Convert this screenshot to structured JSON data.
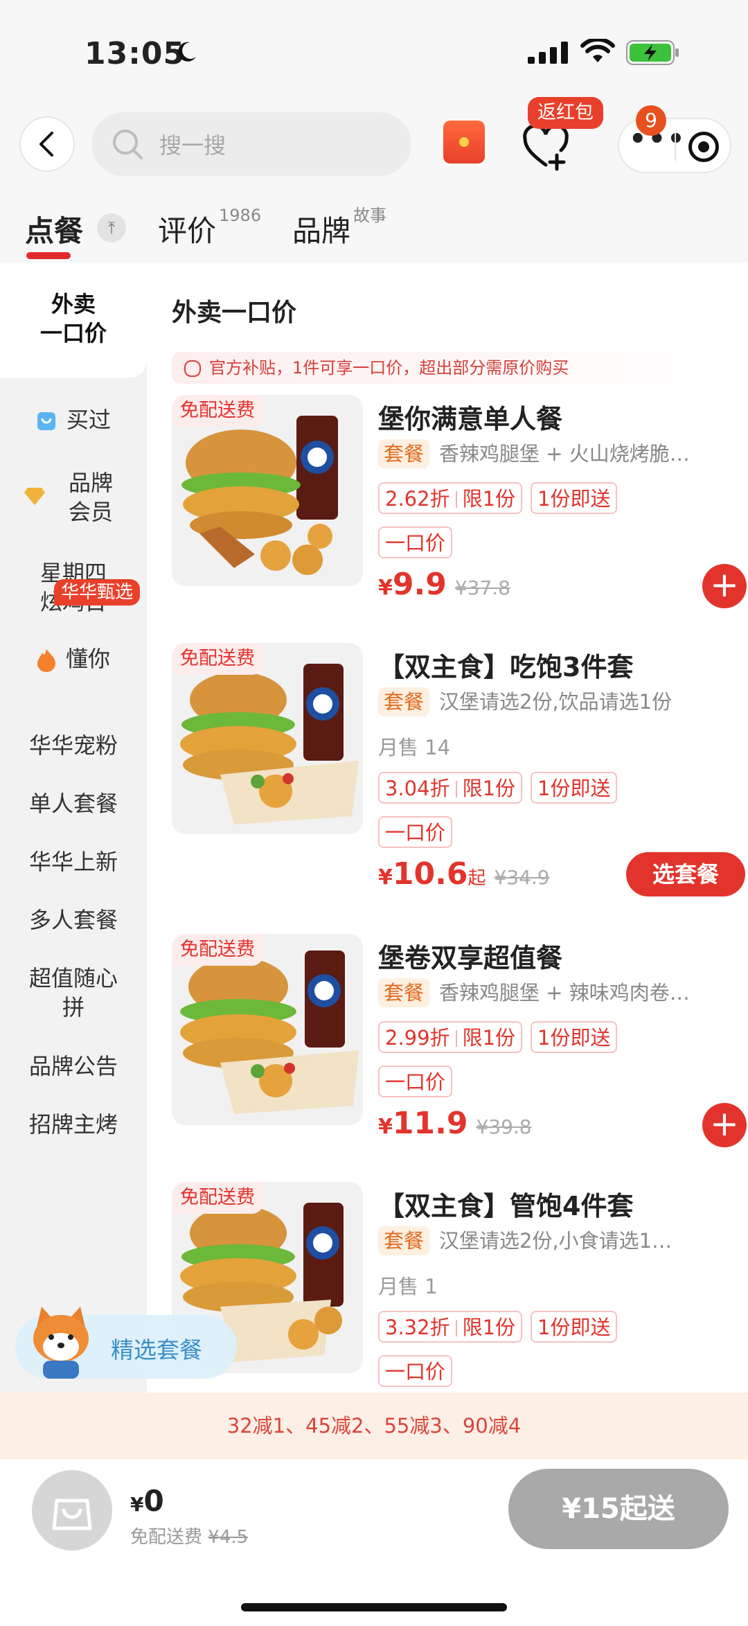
{
  "status_bar": {
    "time": "13:05"
  },
  "header": {
    "search_placeholder": "搜一搜",
    "fav_badge": "返红包",
    "capsule_badge": "9",
    "capsule_dots": "•••"
  },
  "tabs": [
    {
      "label": "点餐",
      "sup": ""
    },
    {
      "label": "评价",
      "sup": "1986"
    },
    {
      "label": "品牌",
      "sup": "故事"
    }
  ],
  "sidebar": {
    "items": [
      {
        "label": "外卖\n一口价"
      },
      {
        "label": "买过"
      },
      {
        "label": "品牌\n会员"
      },
      {
        "label": "星期四\n炫鸡日"
      },
      {
        "label": "懂你"
      },
      {
        "label": "华华宠粉"
      },
      {
        "label": "单人套餐"
      },
      {
        "label": "华华上新"
      },
      {
        "label": "多人套餐"
      },
      {
        "label": "超值随心\n拼"
      },
      {
        "label": "品牌公告"
      },
      {
        "label": "招牌主烤"
      }
    ],
    "badge": "华华甄选"
  },
  "content": {
    "section_title": "外卖一口价",
    "subsidy_text": "官方补贴，1件可享一口价，超出部分需原价购买",
    "products": [
      {
        "free_ship": "免配送费",
        "name": "堡你满意单人餐",
        "tag": "套餐",
        "desc": "香辣鸡腿堡 + 火山烧烤脆…",
        "sales": "",
        "discount": "2.62折",
        "limit": "限1份",
        "instant": "1份即送",
        "one_price": "一口价",
        "currency": "¥",
        "price": "9.9",
        "qi": "",
        "orig": "¥37.8",
        "action": "+"
      },
      {
        "free_ship": "免配送费",
        "name": "【双主食】吃饱3件套",
        "tag": "套餐",
        "desc": "汉堡请选2份,饮品请选1份",
        "sales": "月售 14",
        "discount": "3.04折",
        "limit": "限1份",
        "instant": "1份即送",
        "one_price": "一口价",
        "currency": "¥",
        "price": "10.6",
        "qi": "起",
        "orig": "¥34.9",
        "action": "选套餐"
      },
      {
        "free_ship": "免配送费",
        "name": "堡卷双享超值餐",
        "tag": "套餐",
        "desc": "香辣鸡腿堡 + 辣味鸡肉卷…",
        "sales": "",
        "discount": "2.99折",
        "limit": "限1份",
        "instant": "1份即送",
        "one_price": "一口价",
        "currency": "¥",
        "price": "11.9",
        "qi": "",
        "orig": "¥39.8",
        "action": "+"
      },
      {
        "free_ship": "免配送费",
        "name": "【双主食】管饱4件套",
        "tag": "套餐",
        "desc": "汉堡请选2份,小食请选1…",
        "sales": "月售 1",
        "discount": "3.32折",
        "limit": "限1份",
        "instant": "1份即送",
        "one_price": "一口价",
        "currency": "",
        "price": "",
        "qi": "",
        "orig": "",
        "action": ""
      }
    ]
  },
  "mascot_label": "精选套餐",
  "promo_text": "32减1、45减2、55减3、90减4",
  "cart": {
    "currency": "¥",
    "total": "0",
    "fee_label": "免配送费",
    "fee_orig": "¥4.5",
    "checkout": "¥15起送"
  },
  "colors": {
    "accent": "#e2342c",
    "tag_orange": "#e46a1e",
    "checkout_disabled": "#a9a9a9"
  }
}
